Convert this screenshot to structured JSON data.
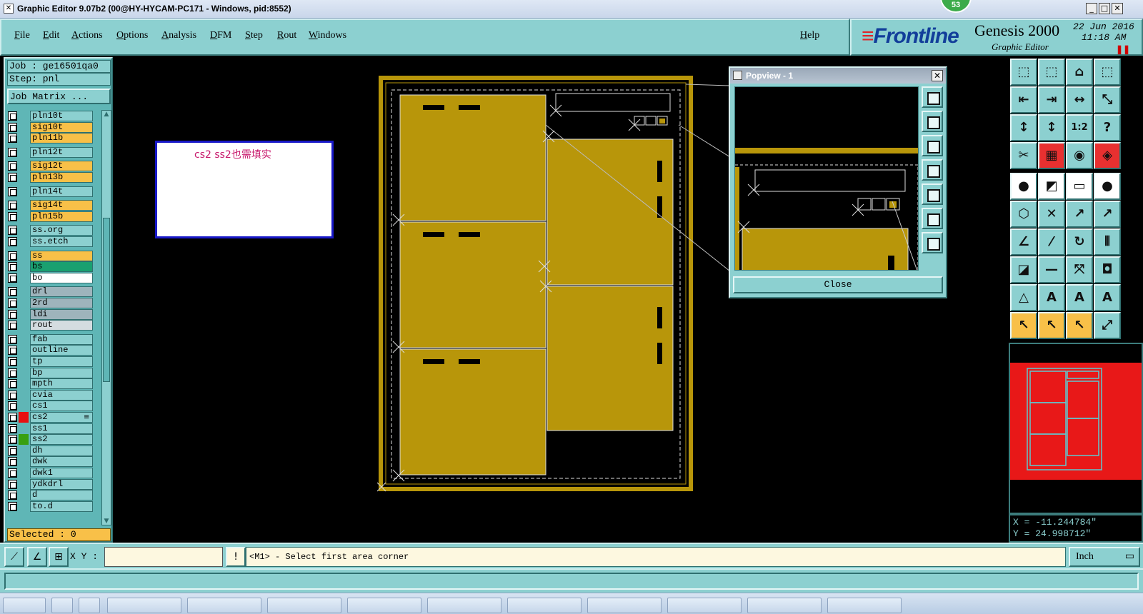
{
  "window": {
    "title": "Graphic Editor 9.07b2 (00@HY-HYCAM-PC171 - Windows, pid:8552)",
    "badge_count": "53",
    "controls": [
      "_",
      "□",
      "✕"
    ]
  },
  "menu": {
    "items": [
      "File",
      "Edit",
      "Actions",
      "Options",
      "Analysis",
      "DFM",
      "Step",
      "Rout",
      "Windows"
    ],
    "help": "Help"
  },
  "brand": {
    "logo_lines": "≡",
    "logo_text": "Frontline",
    "product": "Genesis 2000",
    "subtitle": "Graphic Editor",
    "date": "22 Jun 2016",
    "time": "11:18 AM",
    "pause": "❚❚"
  },
  "left_panel": {
    "job": "Job : ge16501qa0",
    "step": "Step: pnl",
    "job_matrix": "Job Matrix ...",
    "selected": "Selected : 0",
    "layers": [
      {
        "name": "pln10t",
        "color": "#8cd0d0",
        "swatch": ""
      },
      {
        "name": "sig10t",
        "color": "#f8c048",
        "swatch": ""
      },
      {
        "name": "pln11b",
        "color": "#f8c048",
        "swatch": ""
      },
      {
        "name": "pln12t",
        "color": "#8cd0d0",
        "swatch": ""
      },
      {
        "name": "sig12t",
        "color": "#f8c048",
        "swatch": ""
      },
      {
        "name": "pln13b",
        "color": "#f8c048",
        "swatch": ""
      },
      {
        "name": "pln14t",
        "color": "#8cd0d0",
        "swatch": ""
      },
      {
        "name": "sig14t",
        "color": "#f8c048",
        "swatch": ""
      },
      {
        "name": "pln15b",
        "color": "#f8c048",
        "swatch": ""
      },
      {
        "name": "ss.org",
        "color": "#8cd0d0",
        "swatch": ""
      },
      {
        "name": "ss.etch",
        "color": "#8cd0d0",
        "swatch": ""
      },
      {
        "name": "ss",
        "color": "#f8c048",
        "swatch": ""
      },
      {
        "name": "bs",
        "color": "#1aa070",
        "swatch": ""
      },
      {
        "name": "bo",
        "color": "#ffffff",
        "swatch": ""
      },
      {
        "name": "drl",
        "color": "#9eb4bc",
        "swatch": ""
      },
      {
        "name": "2rd",
        "color": "#9eb4bc",
        "swatch": ""
      },
      {
        "name": "ldi",
        "color": "#9eb4bc",
        "swatch": ""
      },
      {
        "name": "rout",
        "color": "#d4dce0",
        "swatch": ""
      },
      {
        "name": "fab",
        "color": "#8cd0d0",
        "swatch": ""
      },
      {
        "name": "outline",
        "color": "#8cd0d0",
        "swatch": ""
      },
      {
        "name": "tp",
        "color": "#8cd0d0",
        "swatch": ""
      },
      {
        "name": "bp",
        "color": "#8cd0d0",
        "swatch": ""
      },
      {
        "name": "mpth",
        "color": "#8cd0d0",
        "swatch": ""
      },
      {
        "name": "cvia",
        "color": "#8cd0d0",
        "swatch": ""
      },
      {
        "name": "cs1",
        "color": "#8cd0d0",
        "swatch": ""
      },
      {
        "name": "cs2",
        "color": "#8cd0d0",
        "swatch": "#e81010",
        "marker": "≡"
      },
      {
        "name": "ss1",
        "color": "#8cd0d0",
        "swatch": ""
      },
      {
        "name": "ss2",
        "color": "#8cd0d0",
        "swatch": "#38a010"
      },
      {
        "name": "dh",
        "color": "#8cd0d0",
        "swatch": ""
      },
      {
        "name": "dwk",
        "color": "#8cd0d0",
        "swatch": ""
      },
      {
        "name": "dwk1",
        "color": "#8cd0d0",
        "swatch": ""
      },
      {
        "name": "ydkdrl",
        "color": "#8cd0d0",
        "swatch": ""
      },
      {
        "name": "d",
        "color": "#8cd0d0",
        "swatch": ""
      },
      {
        "name": "to.d",
        "color": "#8cd0d0",
        "swatch": ""
      }
    ]
  },
  "canvas": {
    "note": "cs2  ss2也需填实",
    "board_color": "#b8960a",
    "outline_color": "#c8a030"
  },
  "popview": {
    "title": "Popview - 1",
    "close_x": "✕",
    "close_button": "Close"
  },
  "toolbox": {
    "glyphs": [
      "⬚",
      "⬚",
      "⌂",
      "⬚",
      "⇤",
      "⇥",
      "↔",
      "⤡",
      "↕",
      "↕",
      "1:2",
      "?",
      "✂",
      "▦",
      "◉",
      "◈",
      "●",
      "◩",
      "▭",
      "●",
      "⬡",
      "✕",
      "↗",
      "↗",
      "∠",
      "⁄",
      "↻",
      "⫴",
      "◪",
      "—",
      "⤧",
      "◘",
      "△",
      "A",
      "A",
      "A",
      "↖",
      "↖",
      "↖",
      "⤢"
    ]
  },
  "coords": {
    "x": "X = -11.244784\"",
    "y": "Y =  24.998712\""
  },
  "command": {
    "xy_label": "X Y :",
    "xy_value": "",
    "alert": "!",
    "prompt": "<M1> - Select first area corner",
    "unit": "Inch",
    "unit_arrow": "▭"
  }
}
